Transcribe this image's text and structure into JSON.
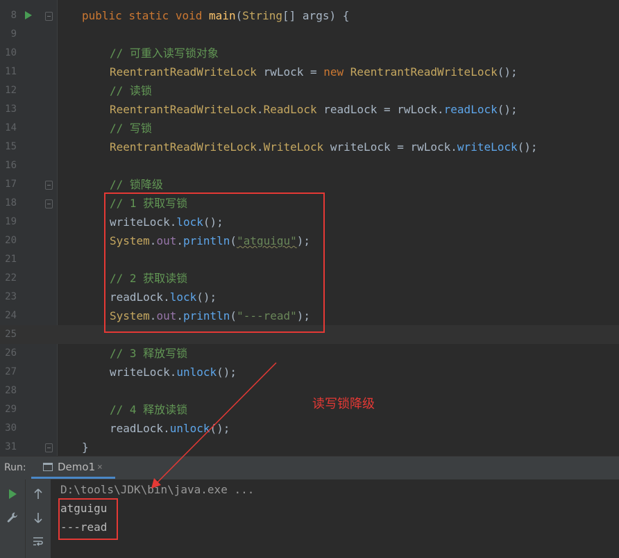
{
  "editor": {
    "lines": [
      {
        "num": "8",
        "indent": 0,
        "tokens": [
          [
            "kw",
            "public "
          ],
          [
            "kw",
            "static "
          ],
          [
            "kw",
            "void "
          ],
          [
            "mtd",
            "main"
          ],
          [
            "p",
            "("
          ],
          [
            "cls",
            "String"
          ],
          [
            "p",
            "[] "
          ],
          [
            "p",
            "args) {"
          ]
        ]
      },
      {
        "num": "9",
        "indent": 0,
        "tokens": []
      },
      {
        "num": "10",
        "indent": 1,
        "tokens": [
          [
            "cmt",
            "// 可重入读写锁对象"
          ]
        ]
      },
      {
        "num": "11",
        "indent": 1,
        "tokens": [
          [
            "cls",
            "ReentrantReadWriteLock "
          ],
          [
            "p",
            "rwLock = "
          ],
          [
            "kw",
            "new "
          ],
          [
            "cls",
            "ReentrantReadWriteLock"
          ],
          [
            "p",
            "();"
          ]
        ]
      },
      {
        "num": "12",
        "indent": 1,
        "tokens": [
          [
            "cmt",
            "// 读锁"
          ]
        ]
      },
      {
        "num": "13",
        "indent": 1,
        "tokens": [
          [
            "cls",
            "ReentrantReadWriteLock"
          ],
          [
            "p",
            "."
          ],
          [
            "cls",
            "ReadLock "
          ],
          [
            "p",
            "readLock = rwLock."
          ],
          [
            "call",
            "readLock"
          ],
          [
            "p",
            "();"
          ]
        ]
      },
      {
        "num": "14",
        "indent": 1,
        "tokens": [
          [
            "cmt",
            "// 写锁"
          ]
        ]
      },
      {
        "num": "15",
        "indent": 1,
        "tokens": [
          [
            "cls",
            "ReentrantReadWriteLock"
          ],
          [
            "p",
            "."
          ],
          [
            "cls",
            "WriteLock "
          ],
          [
            "p",
            "writeLock = rwLock."
          ],
          [
            "call",
            "writeLock"
          ],
          [
            "p",
            "();"
          ]
        ]
      },
      {
        "num": "16",
        "indent": 0,
        "tokens": []
      },
      {
        "num": "17",
        "indent": 1,
        "tokens": [
          [
            "cmt",
            "// 锁降级"
          ]
        ]
      },
      {
        "num": "18",
        "indent": 1,
        "tokens": [
          [
            "cmt",
            "// 1 获取写锁"
          ]
        ]
      },
      {
        "num": "19",
        "indent": 1,
        "tokens": [
          [
            "p",
            "writeLock."
          ],
          [
            "call",
            "lock"
          ],
          [
            "p",
            "();"
          ]
        ]
      },
      {
        "num": "20",
        "indent": 1,
        "tokens": [
          [
            "cls",
            "System"
          ],
          [
            "p",
            "."
          ],
          [
            "fld",
            "out"
          ],
          [
            "p",
            "."
          ],
          [
            "call",
            "println"
          ],
          [
            "p",
            "("
          ],
          [
            "str",
            "\"atguigu\""
          ],
          [
            "p",
            ");"
          ]
        ]
      },
      {
        "num": "21",
        "indent": 0,
        "tokens": []
      },
      {
        "num": "22",
        "indent": 1,
        "tokens": [
          [
            "cmt",
            "// 2 获取读锁"
          ]
        ]
      },
      {
        "num": "23",
        "indent": 1,
        "tokens": [
          [
            "p",
            "readLock."
          ],
          [
            "call",
            "lock"
          ],
          [
            "p",
            "();"
          ]
        ]
      },
      {
        "num": "24",
        "indent": 1,
        "tokens": [
          [
            "cls",
            "System"
          ],
          [
            "p",
            "."
          ],
          [
            "fld",
            "out"
          ],
          [
            "p",
            "."
          ],
          [
            "call",
            "println"
          ],
          [
            "p",
            "("
          ],
          [
            "str",
            "\"---read\""
          ],
          [
            "p",
            ");"
          ]
        ]
      },
      {
        "num": "25",
        "indent": 0,
        "tokens": []
      },
      {
        "num": "26",
        "indent": 1,
        "tokens": [
          [
            "cmt",
            "// 3 释放写锁"
          ]
        ]
      },
      {
        "num": "27",
        "indent": 1,
        "tokens": [
          [
            "p",
            "writeLock."
          ],
          [
            "call",
            "unlock"
          ],
          [
            "p",
            "();"
          ]
        ]
      },
      {
        "num": "28",
        "indent": 0,
        "tokens": []
      },
      {
        "num": "29",
        "indent": 1,
        "tokens": [
          [
            "cmt",
            "// 4 释放读锁"
          ]
        ]
      },
      {
        "num": "30",
        "indent": 1,
        "tokens": [
          [
            "p",
            "readLock."
          ],
          [
            "call",
            "unlock"
          ],
          [
            "p",
            "();"
          ]
        ]
      },
      {
        "num": "31",
        "indent": 0,
        "tokens": [
          [
            "p",
            "}"
          ]
        ]
      }
    ],
    "current_line": "25"
  },
  "annotation": {
    "text": "读写锁降级"
  },
  "run_panel": {
    "label": "Run:",
    "tab_label": "Demo1",
    "tab_close": "×",
    "console": {
      "command": "D:\\tools\\JDK\\bin\\java.exe ...",
      "output": [
        "atguigu",
        "---read"
      ]
    }
  },
  "colors": {
    "accent_tab": "#4a88c7",
    "annotation_red": "#e53935",
    "run_green": "#499c54"
  }
}
